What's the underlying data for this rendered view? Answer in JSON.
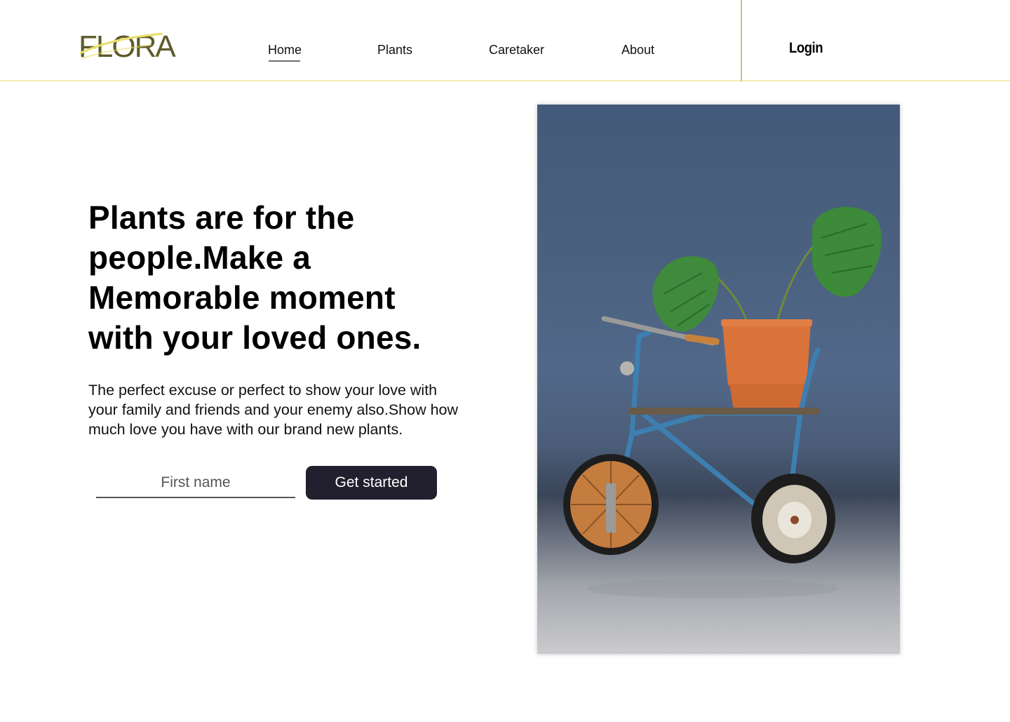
{
  "brand": {
    "logo_text": "FLORA"
  },
  "nav": {
    "items": [
      {
        "label": "Home",
        "active": true
      },
      {
        "label": "Plants",
        "active": false
      },
      {
        "label": "Caretaker",
        "active": false
      },
      {
        "label": "About",
        "active": false
      }
    ],
    "login_label": "Login"
  },
  "hero": {
    "title": "Plants are for the\npeople.Make  a\nMemorable moment\nwith your loved ones.",
    "body": "The perfect excuse or perfect to show your love with\nyour family and friends and your enemy also.Show how\nmuch love you have with our brand new plants.",
    "input_placeholder": "First name",
    "cta_label": "Get started"
  },
  "colors": {
    "accent_line": "#f3ecb0",
    "divider": "#cdbf8e",
    "logo": "#5e5a2a",
    "button_bg": "#22202e"
  }
}
